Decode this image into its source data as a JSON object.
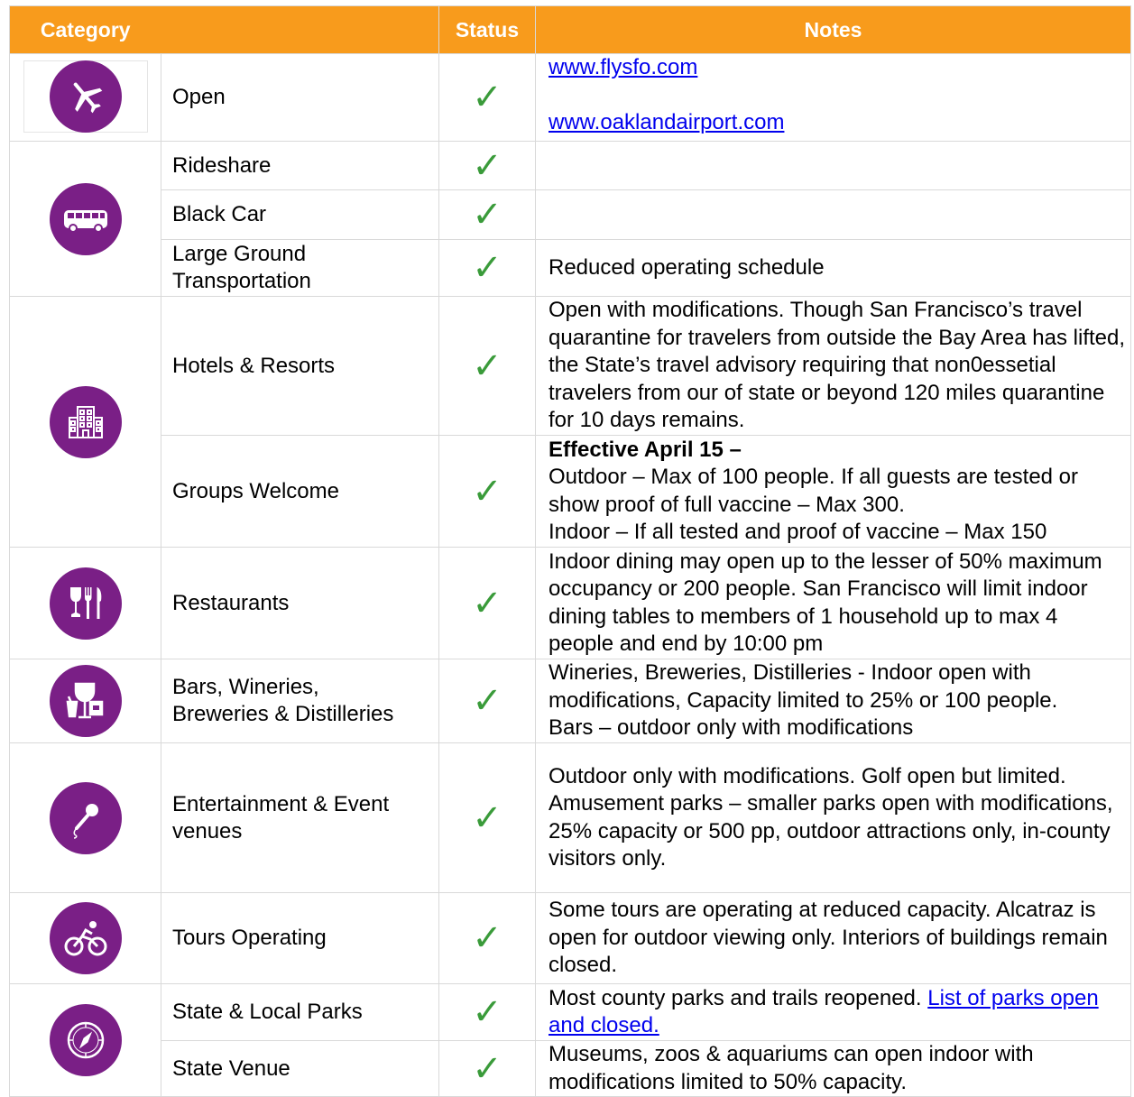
{
  "header": {
    "category": "Category",
    "status": "Status",
    "notes": "Notes"
  },
  "status_mark": "✓",
  "icons": {
    "airport": "airplane-icon",
    "transportation": "bus-icon",
    "hotels": "building-icon",
    "restaurants": "dining-icon",
    "bars": "drinks-icon",
    "entertainment": "microphone-icon",
    "tours": "bicycle-icon",
    "parks": "compass-icon"
  },
  "colors": {
    "header_bg": "#f89b1c",
    "icon_bg": "#7a1f86",
    "check": "#3a9b3a",
    "link": "#0000ee"
  },
  "rows": {
    "open": {
      "label": "Open",
      "link1": "www.flysfo.com",
      "link2": "www.oaklandairport.com"
    },
    "rideshare": {
      "label": "Rideshare",
      "note": ""
    },
    "black_car": {
      "label": "Black Car",
      "note": ""
    },
    "large_ground": {
      "label_line1": "Large Ground",
      "label_line2": "Transportation",
      "note": "Reduced operating schedule"
    },
    "hotels": {
      "label": "Hotels & Resorts",
      "note": "Open with modifications. Though San Francisco’s travel quarantine for travelers from outside the Bay Area has lifted, the State’s travel advisory requiring that non0essetial travelers from our of state or beyond 120 miles quarantine for 10 days remains."
    },
    "groups": {
      "label": "Groups Welcome",
      "note_heading": "Effective April 15 –",
      "note_line1": "Outdoor – Max of 100 people.  If all guests are tested or show proof of full vaccine – Max 300.",
      "note_line2": "Indoor – If all tested and proof of vaccine – Max 150"
    },
    "restaurants": {
      "label": "Restaurants",
      "note": "Indoor dining may open up to the lesser of 50% maximum occupancy or 200 people.  San Francisco will limit indoor dining tables to members of 1 household up to max 4 people and end by 10:00 pm"
    },
    "bars": {
      "label_line1": "Bars, Wineries,",
      "label_line2": "Breweries & Distilleries",
      "note_line1": "Wineries, Breweries, Distilleries - Indoor open with modifications, Capacity limited to 25% or 100 people.",
      "note_line2": "Bars – outdoor only with modifications"
    },
    "entertainment": {
      "label_line1": "Entertainment & Event",
      "label_line2": "venues",
      "note": "Outdoor only with modifications.  Golf open but limited. Amusement parks – smaller parks open with modifications, 25% capacity or 500 pp, outdoor attractions only, in-county visitors only."
    },
    "tours": {
      "label": "Tours Operating",
      "note": "Some tours are operating at reduced capacity. Alcatraz is open for outdoor viewing only. Interiors of buildings remain closed."
    },
    "parks": {
      "label": "State & Local Parks",
      "note_text": "Most county parks and trails reopened. ",
      "note_link": "List of parks open and closed."
    },
    "state_venue": {
      "label": "State Venue",
      "note": "Museums, zoos & aquariums can open indoor with modifications limited to 50% capacity."
    }
  }
}
